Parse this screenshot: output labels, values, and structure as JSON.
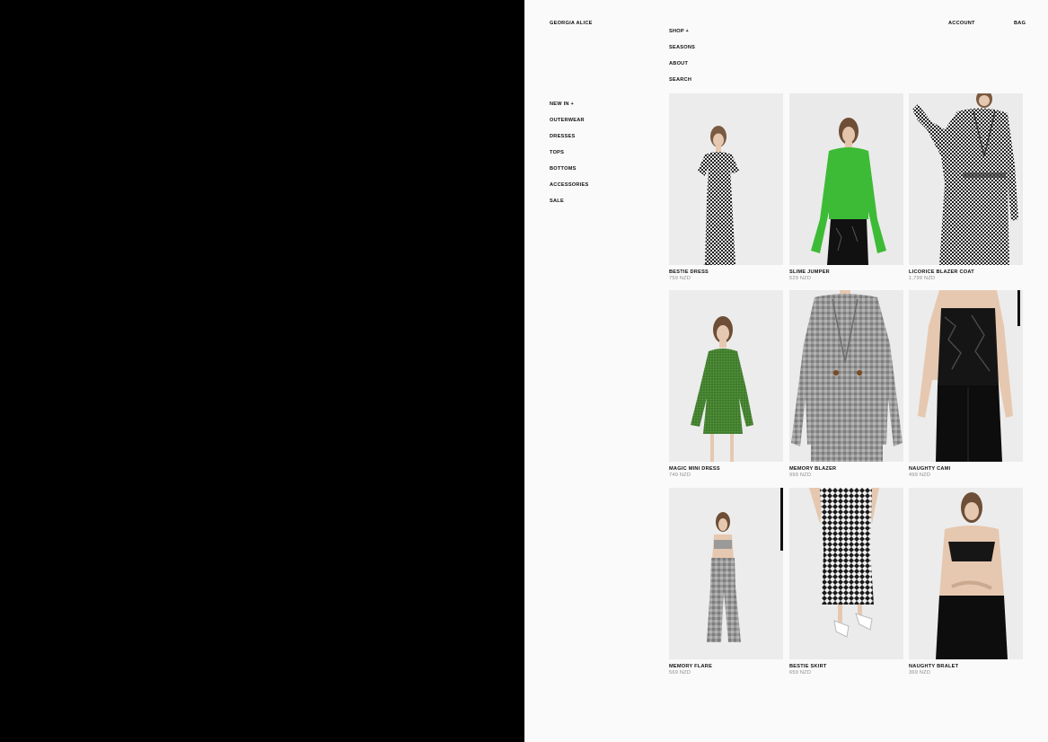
{
  "header": {
    "logo": "GEORGIA ALICE",
    "nav": [
      "SHOP +",
      "SEASONS",
      "ABOUT",
      "SEARCH"
    ],
    "account": "ACCOUNT",
    "bag": "BAG"
  },
  "categories": [
    "NEW IN +",
    "OUTERWEAR",
    "DRESSES",
    "TOPS",
    "BOTTOMS",
    "ACCESSORIES",
    "SALE"
  ],
  "products": [
    {
      "name": "BESTIE DRESS",
      "price": "759 NZD"
    },
    {
      "name": "SLIME JUMPER",
      "price": "529 NZD"
    },
    {
      "name": "LICORICE BLAZER COAT",
      "price": "1,799 NZD"
    },
    {
      "name": "MAGIC MINI DRESS",
      "price": "749 NZD"
    },
    {
      "name": "MEMORY BLAZER",
      "price": "999 NZD"
    },
    {
      "name": "NAUGHTY CAMI",
      "price": "499 NZD"
    },
    {
      "name": "MEMORY FLARE",
      "price": "569 NZD"
    },
    {
      "name": "BESTIE SKIRT",
      "price": "659 NZD"
    },
    {
      "name": "NAUGHTY BRALET",
      "price": "369 NZD"
    }
  ],
  "colors": {
    "page_background": "#fafafa",
    "side_panel": "#000000",
    "text": "#111111",
    "price_text": "#8a8a8a",
    "photo_background": "#ebebeb"
  }
}
